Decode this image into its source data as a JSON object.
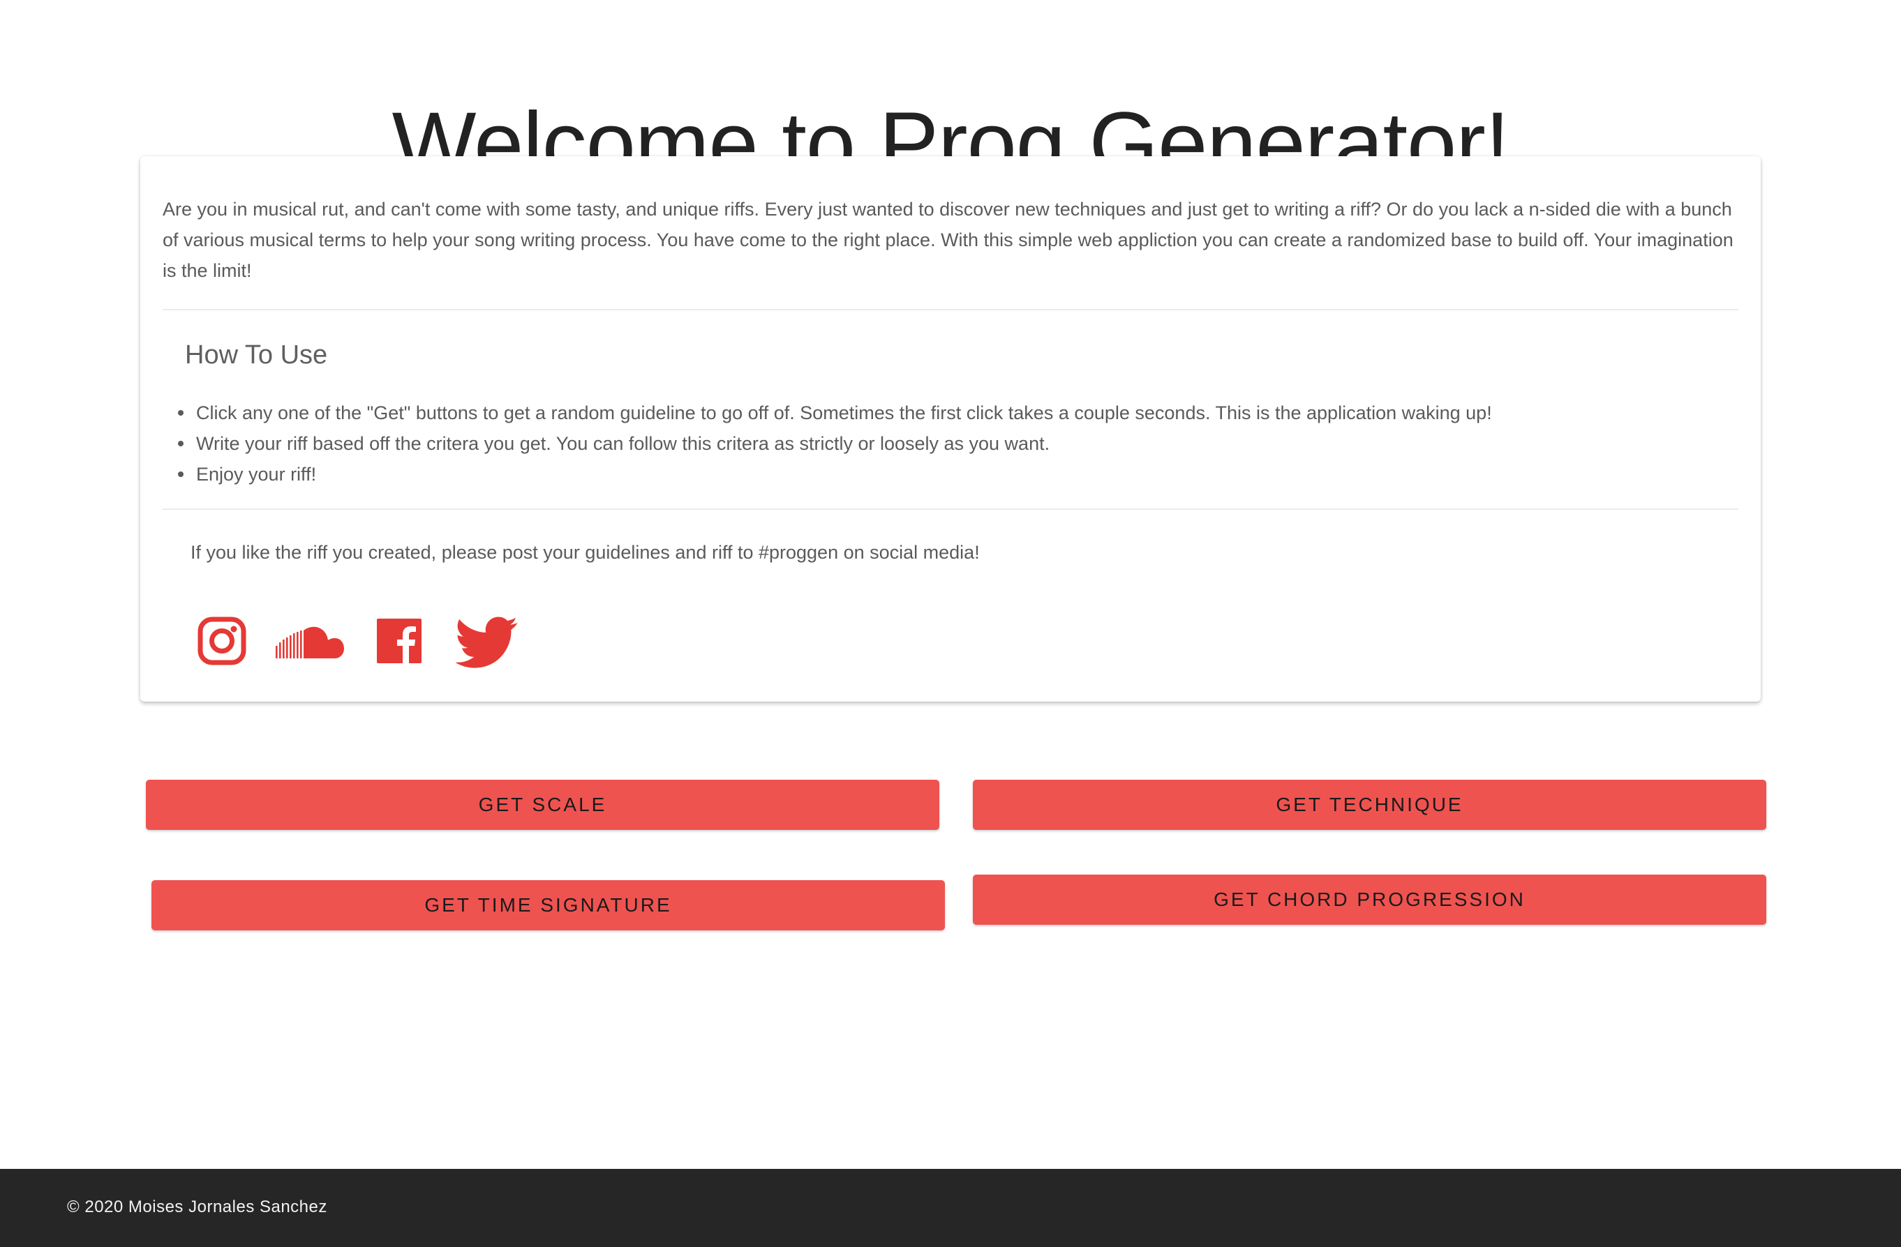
{
  "page": {
    "title": "Welcome to Prog Generator!"
  },
  "card": {
    "intro": "Are you in musical rut, and can't come with some tasty, and unique riffs. Every just wanted to discover new techniques and just get to writing a riff? Or do you lack a n-sided die with a bunch of various musical terms to help your song writing process. You have come to the right place. With this simple web appliction you can create a randomized base to build off. Your imagination is the limit!",
    "howto_heading": "How To Use",
    "steps": [
      "Click any one of the \"Get\" buttons to get a random guideline to go off of. Sometimes the first click takes a couple seconds. This is the application waking up!",
      "Write your riff based off the critera you get. You can follow this critera as strictly or loosely as you want.",
      "Enjoy your riff!"
    ],
    "share_text": "If you like the riff you created, please post your guidelines and riff to #proggen on social media!",
    "socials": [
      {
        "icon": "instagram-icon"
      },
      {
        "icon": "soundcloud-icon"
      },
      {
        "icon": "facebook-icon"
      },
      {
        "icon": "twitter-icon"
      }
    ]
  },
  "buttons": {
    "scale": "GET SCALE",
    "technique": "GET TECHNIQUE",
    "time_signature": "GET TIME SIGNATURE",
    "chord_progression": "GET CHORD PROGRESSION"
  },
  "footer": {
    "copyright": "© 2020 Moises Jornales Sanchez"
  },
  "colors": {
    "accent": "#ef5350",
    "icon": "#e53935",
    "footer_bg": "#262626",
    "title_text": "#222222",
    "body_text": "#5a5a5a"
  }
}
